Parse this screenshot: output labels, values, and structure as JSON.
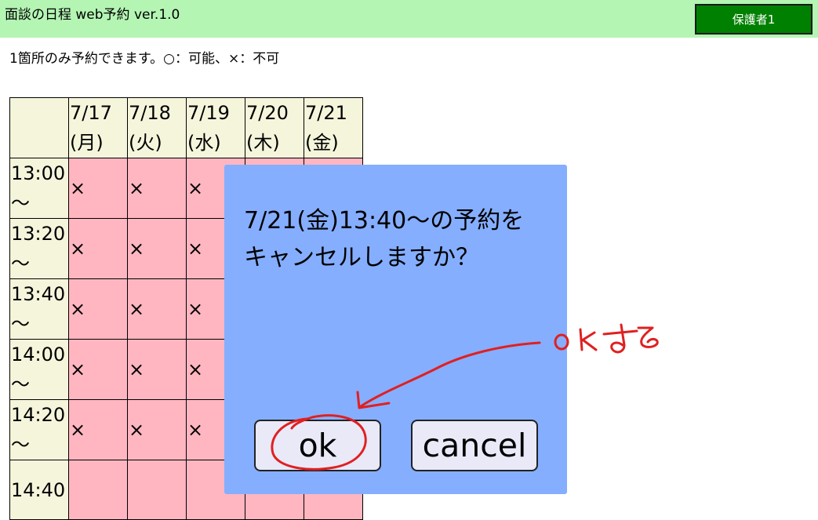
{
  "header": {
    "title": "面談の日程 web予約 ver.1.0",
    "user_button": "保護者1"
  },
  "notice": "1箇所のみ予約できます。○：可能、×：不可",
  "schedule": {
    "dates": [
      {
        "date": "7/17",
        "day": "(月)"
      },
      {
        "date": "7/18",
        "day": "(火)"
      },
      {
        "date": "7/19",
        "day": "(水)"
      },
      {
        "date": "7/20",
        "day": "(木)"
      },
      {
        "date": "7/21",
        "day": "(金)"
      }
    ],
    "rows": [
      {
        "time": "13:00",
        "tilde": "～",
        "slots": [
          "×",
          "×",
          "×"
        ]
      },
      {
        "time": "13:20",
        "tilde": "～",
        "slots": [
          "×",
          "×",
          "×"
        ]
      },
      {
        "time": "13:40",
        "tilde": "～",
        "slots": [
          "×",
          "×",
          "×"
        ]
      },
      {
        "time": "14:00",
        "tilde": "～",
        "slots": [
          "×",
          "×",
          "×"
        ]
      },
      {
        "time": "14:20",
        "tilde": "～",
        "slots": [
          "×",
          "×",
          "×"
        ]
      },
      {
        "time": "14:40",
        "tilde": "",
        "slots": [
          "",
          "",
          ""
        ]
      }
    ]
  },
  "dialog": {
    "message_line1": "7/21(金)13:40～の予約を",
    "message_line2": "キャンセルしますか？",
    "ok_label": "ok",
    "cancel_label": "cancel"
  },
  "annotation": {
    "handwritten_note": "OKする",
    "color": "#e02020"
  },
  "colors": {
    "header_bg": "#b4f5b4",
    "user_button_bg": "#008000",
    "header_cell_bg": "#f5f5dc",
    "slot_bg": "#ffb6c1",
    "dialog_bg": "#85aeff",
    "dialog_button_bg": "#e9e9f8"
  }
}
